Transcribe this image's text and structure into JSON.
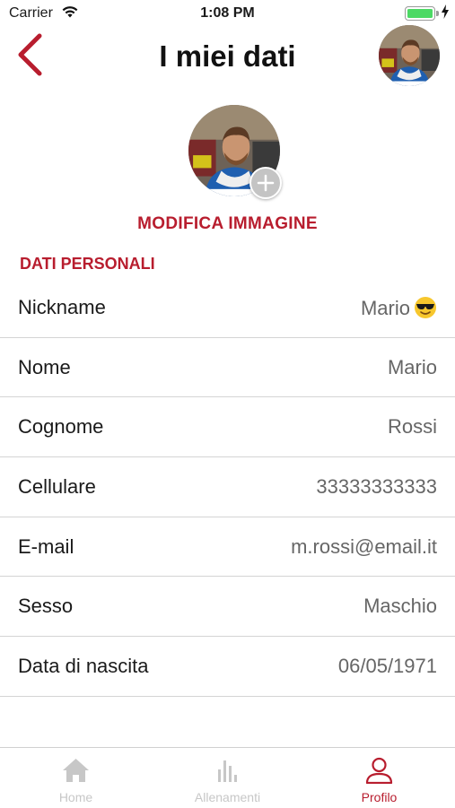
{
  "status_bar": {
    "carrier": "Carrier",
    "time": "1:08 PM",
    "battery_level": 1.0
  },
  "header": {
    "title": "I miei dati"
  },
  "profile": {
    "edit_image_label": "MODIFICA IMMAGINE"
  },
  "section": {
    "title": "DATI PERSONALI"
  },
  "fields": [
    {
      "label": "Nickname",
      "value": "Mario",
      "emoji": "smiling-face-with-sunglasses"
    },
    {
      "label": "Nome",
      "value": "Mario"
    },
    {
      "label": "Cognome",
      "value": "Rossi"
    },
    {
      "label": "Cellulare",
      "value": "33333333333"
    },
    {
      "label": "E-mail",
      "value": "m.rossi@email.it"
    },
    {
      "label": "Sesso",
      "value": "Maschio"
    },
    {
      "label": "Data di nascita",
      "value": "06/05/1971"
    }
  ],
  "tabbar": {
    "tabs": [
      {
        "label": "Home",
        "icon": "home-icon",
        "active": false
      },
      {
        "label": "Allenamenti",
        "icon": "bar-chart-icon",
        "active": false
      },
      {
        "label": "Profilo",
        "icon": "user-icon",
        "active": true
      }
    ]
  },
  "colors": {
    "accent": "#b81d2e",
    "inactive_tab": "#c7c7c7",
    "value_text": "#666666",
    "battery": "#4cd964"
  }
}
